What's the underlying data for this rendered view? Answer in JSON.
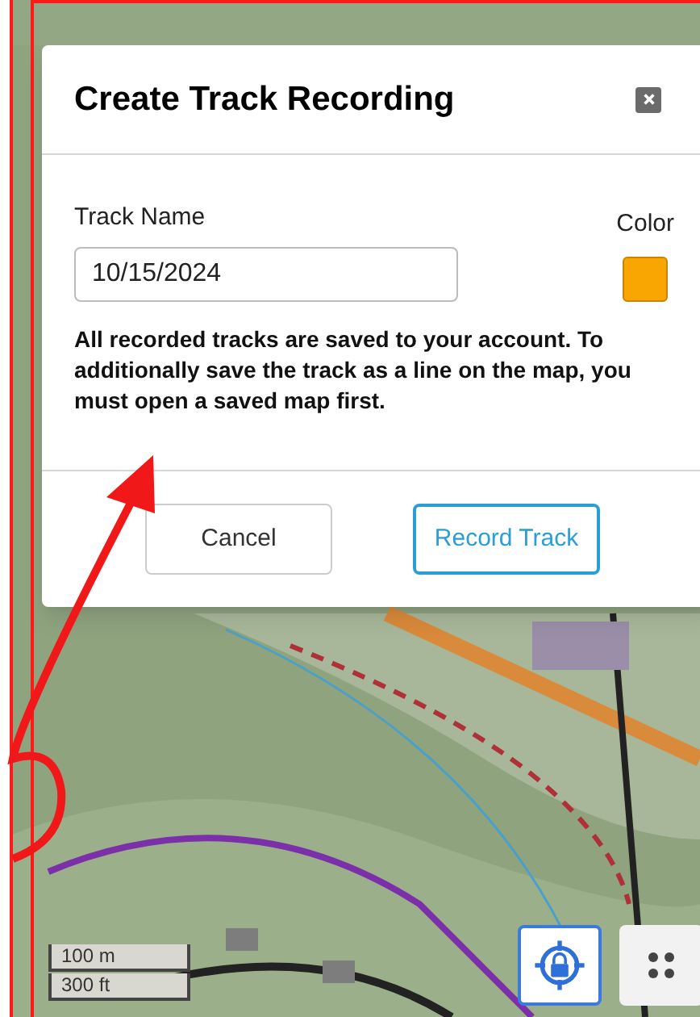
{
  "dialog": {
    "title": "Create Track Recording",
    "track_name": {
      "label": "Track Name",
      "value": "10/15/2024"
    },
    "color_field": {
      "label": "Color",
      "color": "#f9a602"
    },
    "note": "All recorded tracks are saved to your account. To additionally save the track as a line on the map, you must open a saved map first.",
    "buttons": [
      {
        "label": "Cancel",
        "kind": "secondary"
      },
      {
        "label": "Record Track",
        "kind": "primary"
      }
    ]
  },
  "scale": [
    "100 m",
    "300 ft"
  ]
}
